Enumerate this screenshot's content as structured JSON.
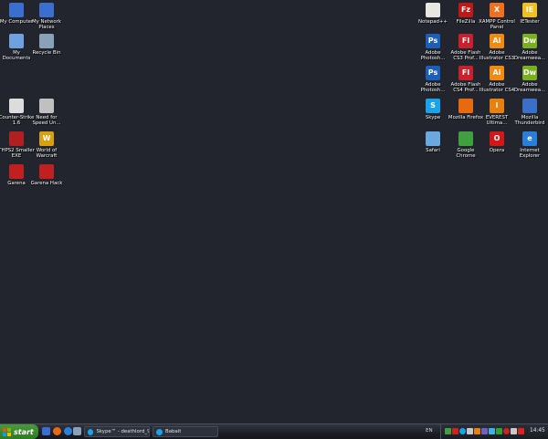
{
  "desktop_icons_left": [
    {
      "label": "My Computer",
      "icon": "computer-icon",
      "color": "#3a6fd0",
      "glyph": ""
    },
    {
      "label": "My Network\nPlaces",
      "icon": "network-places-icon",
      "color": "#3a6fd0",
      "glyph": ""
    },
    {
      "label": "My Documents",
      "icon": "documents-folder-icon",
      "color": "#6fa0e0",
      "glyph": ""
    },
    {
      "label": "Recycle Bin",
      "icon": "recycle-bin-icon",
      "color": "#8aa2b8",
      "glyph": ""
    },
    {
      "label": "Counter-Strike\n1.6",
      "icon": "counter-strike-icon",
      "color": "#dcdcdc",
      "glyph": ""
    },
    {
      "label": "Need for\nSpeed Un...",
      "icon": "need-for-speed-icon",
      "color": "#c0c0c0",
      "glyph": ""
    },
    {
      "label": "THPS2 Smaller\nEXE",
      "icon": "thps2-icon",
      "color": "#b02020",
      "glyph": ""
    },
    {
      "label": "World of\nWarcraft",
      "icon": "world-of-warcraft-icon",
      "color": "#d8a010",
      "glyph": "W"
    },
    {
      "label": "Garena",
      "icon": "garena-icon",
      "color": "#c02020",
      "glyph": ""
    },
    {
      "label": "Garena Hack",
      "icon": "garena-hack-icon",
      "color": "#c02020",
      "glyph": ""
    }
  ],
  "desktop_icons_right": [
    {
      "label": "Notepad++",
      "icon": "notepad-plus-plus-icon",
      "color": "#e8e8e0",
      "glyph": ""
    },
    {
      "label": "FileZilla",
      "icon": "filezilla-icon",
      "color": "#c01818",
      "glyph": "Fz"
    },
    {
      "label": "XAMPP Control\nPanel",
      "icon": "xampp-icon",
      "color": "#f07020",
      "glyph": "X"
    },
    {
      "label": "IETester",
      "icon": "ietester-icon",
      "color": "#f0c020",
      "glyph": "IE"
    },
    {
      "label": "Adobe\nPhotosh...",
      "icon": "photoshop-icon",
      "color": "#1c5fb8",
      "glyph": "Ps"
    },
    {
      "label": "Adobe Flash\nCS3 Prof...",
      "icon": "flash-cs3-icon",
      "color": "#c8202c",
      "glyph": "Fl"
    },
    {
      "label": "Adobe\nIllustrator CS3",
      "icon": "illustrator-cs3-icon",
      "color": "#f08a10",
      "glyph": "Ai"
    },
    {
      "label": "Adobe\nDreamwea...",
      "icon": "dreamweaver-icon",
      "color": "#7ab020",
      "glyph": "Dw"
    },
    {
      "label": "Adobe\nPhotosh...",
      "icon": "photoshop-cs4-icon",
      "color": "#1c5fb8",
      "glyph": "Ps"
    },
    {
      "label": "Adobe Flash\nCS4 Prof...",
      "icon": "flash-cs4-icon",
      "color": "#c8202c",
      "glyph": "Fl"
    },
    {
      "label": "Adobe\nIllustrator CS4",
      "icon": "illustrator-cs4-icon",
      "color": "#f08a10",
      "glyph": "Ai"
    },
    {
      "label": "Adobe\nDreamwea...",
      "icon": "dreamweaver-cs4-icon",
      "color": "#7ab020",
      "glyph": "Dw"
    },
    {
      "label": "Skype",
      "icon": "skype-icon",
      "color": "#1aa3e8",
      "glyph": "S"
    },
    {
      "label": "Mozilla Firefox",
      "icon": "firefox-icon",
      "color": "#e86a10",
      "glyph": ""
    },
    {
      "label": "EVEREST\nUltima...",
      "icon": "everest-icon",
      "color": "#e88010",
      "glyph": "i"
    },
    {
      "label": "Mozilla\nThunderbird",
      "icon": "thunderbird-icon",
      "color": "#3a70c8",
      "glyph": ""
    },
    {
      "label": "Safari",
      "icon": "safari-icon",
      "color": "#6aa8e0",
      "glyph": ""
    },
    {
      "label": "Google\nChrome",
      "icon": "chrome-icon",
      "color": "#40a040",
      "glyph": ""
    },
    {
      "label": "Opera",
      "icon": "opera-icon",
      "color": "#d01818",
      "glyph": "O"
    },
    {
      "label": "Internet\nExplorer",
      "icon": "internet-explorer-icon",
      "color": "#2a80d8",
      "glyph": "e"
    }
  ],
  "taskbar": {
    "start_label": "start",
    "tasks": [
      {
        "label": "Skype™ - deathlord_93",
        "icon": "skype-icon"
      },
      {
        "label": "Babait",
        "icon": "skype-icon"
      }
    ],
    "language": "EN",
    "clock": "14:45"
  }
}
